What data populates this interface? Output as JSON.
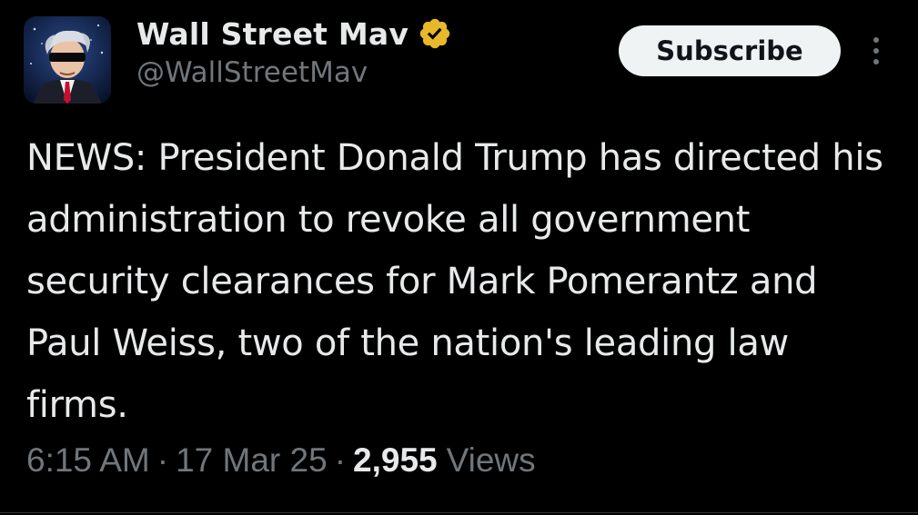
{
  "author": {
    "display_name": "Wall Street Mav",
    "handle": "@WallStreetMav",
    "verified_icon": "verified-badge-gold",
    "verified_color": "#e8b829"
  },
  "actions": {
    "subscribe_label": "Subscribe",
    "more_icon": "more-vertical-icon"
  },
  "tweet": {
    "text": "NEWS: President Donald Trump has directed his administration to revoke all government security clearances for Mark Pomerantz and Paul Weiss, two of the nation's leading law firms."
  },
  "meta": {
    "time": "6:15 AM",
    "separator": "·",
    "date": "17 Mar 25",
    "views_count": "2,955",
    "views_label": "Views"
  },
  "colors": {
    "background": "#000000",
    "primary_text": "#e7e9ea",
    "secondary_text": "#71767b",
    "button_bg": "#eff3f4"
  }
}
